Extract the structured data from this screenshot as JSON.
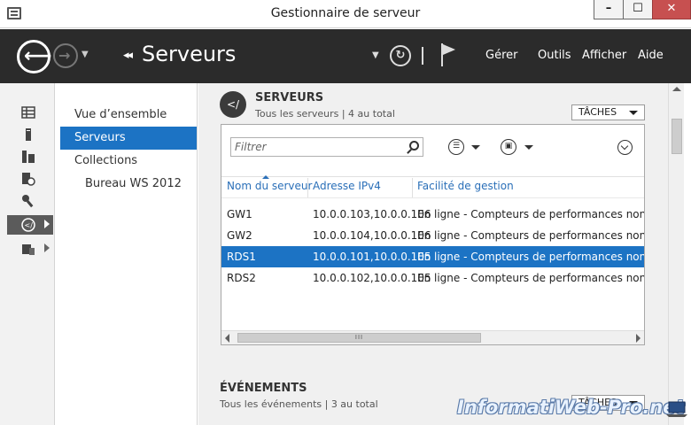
{
  "window": {
    "title": "Gestionnaire de serveur",
    "min_label": "–",
    "max_label": "☐",
    "close_label": "✕"
  },
  "header": {
    "breadcrumb_arrows": "◂◂",
    "title": "Serveurs",
    "menu": {
      "manage": "Gérer",
      "tools": "Outils",
      "view": "Afficher",
      "help": "Aide"
    }
  },
  "nav": {
    "items": [
      {
        "label": "Vue d’ensemble"
      },
      {
        "label": "Serveurs"
      },
      {
        "label": "Collections"
      },
      {
        "label": "Bureau WS 2012"
      }
    ]
  },
  "servers": {
    "title": "SERVEURS",
    "subtitle": "Tous les serveurs | 4 au total",
    "tasks_label": "TÂCHES",
    "filter_placeholder": "Filtrer",
    "columns": [
      "Nom du serveur",
      "Adresse IPv4",
      "Facilité de gestion"
    ],
    "rows": [
      {
        "name": "GW1",
        "ip": "10.0.0.103,10.0.0.106",
        "status": "En ligne - Compteurs de performances non démarrés"
      },
      {
        "name": "GW2",
        "ip": "10.0.0.104,10.0.0.106",
        "status": "En ligne - Compteurs de performances non démarrés"
      },
      {
        "name": "RDS1",
        "ip": "10.0.0.101,10.0.0.105",
        "status": "En ligne - Compteurs de performances non démarrés"
      },
      {
        "name": "RDS2",
        "ip": "10.0.0.102,10.0.0.105",
        "status": "En ligne - Compteurs de performances non démarrés"
      }
    ],
    "selected_row": "RDS1",
    "scroll_grip": "III"
  },
  "events": {
    "title": "ÉVÉNEMENTS",
    "subtitle": "Tous les événements | 3 au total",
    "tasks_label": "TÂCHES"
  },
  "watermark": "InformatiWeb-Pro.net",
  "colors": {
    "header_bg": "#2b2b2b",
    "accent": "#1c73c4",
    "close_button": "#c75050"
  }
}
